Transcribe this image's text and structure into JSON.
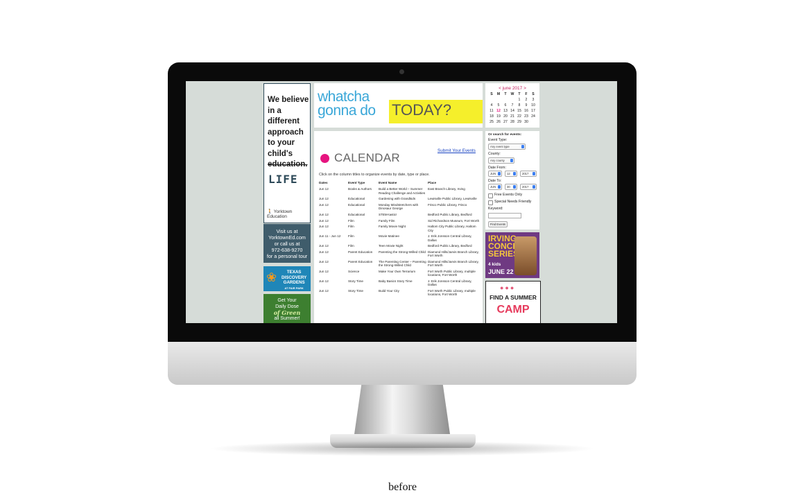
{
  "caption": "before",
  "left_ads": {
    "ad1_lines": [
      "We believe",
      "in a",
      "different",
      "approach",
      "to your",
      "child's",
      "education."
    ],
    "ad1_life": "LIFE",
    "ad1_logo": "Yorktown Education",
    "ad2_lines": [
      "Visit us at",
      "YorktownEd.com",
      "or call us at",
      "972-638-9270",
      "for a personal tour"
    ],
    "ad3_lines": [
      "TEXAS",
      "DISCOVERY",
      "GARDENS",
      "AT FAIR PARK"
    ],
    "ad4_lines": [
      "Get Your",
      "Daily Dose",
      "of Green",
      "all Summer!"
    ]
  },
  "banner": {
    "line1": "whatcha",
    "line2": "gonna do",
    "today": "TODAY?"
  },
  "calendar": {
    "title": "CALENDAR",
    "submit_link": "Submit Your Events",
    "intro": "Click on the column titles to organize events by date, type or place.",
    "columns": [
      "Dates",
      "Event Type",
      "Event Name",
      "Place"
    ],
    "rows": [
      [
        "Jun 12",
        "Books & Authors",
        "Build a Better World – Summer Reading Challenge and Activities",
        "East Branch Library, Irving"
      ],
      [
        "Jun 12",
        "Educational",
        "Gardening with Grandkids",
        "Lewisville Public Library, Lewisville"
      ],
      [
        "Jun 12",
        "Educational",
        "Monday Mindstretchers with Dinosaur George",
        "Frisco Public Library, Frisco"
      ],
      [
        "Jun 12",
        "Educational",
        "STEM-tastic!",
        "Bedford Public Library, Bedford"
      ],
      [
        "Jun 12",
        "Film",
        "Family Film",
        "Sid Richardson Museum, Fort Worth"
      ],
      [
        "Jun 12",
        "Film",
        "Family Movie Night",
        "Haltom City Public Library, Haltom City"
      ],
      [
        "Jun 11 - Jun 12",
        "Film",
        "Movie Matinee",
        "J. Erik Jonsson Central Library, Dallas"
      ],
      [
        "Jun 12",
        "Film",
        "Teen Movie Night",
        "Bedford Public Library, Bedford"
      ],
      [
        "Jun 12",
        "Parent Education",
        "Parenting the Strong-Willed Child",
        "Diamond Hills/Jarvis Branch Library, Fort Worth"
      ],
      [
        "Jun 12",
        "Parent Education",
        "The Parenting Center – Parenting the Strong-Willed Child",
        "Diamond Hills/Jarvis Branch Library, Fort Worth"
      ],
      [
        "Jun 12",
        "Science",
        "Make Your Own Terrarium",
        "Fort Worth Public Library, multiple locations, Fort Worth"
      ],
      [
        "Jun 12",
        "Story Time",
        "Baby Basics Story Time",
        "J. Erik Jonsson Central Library, Dallas"
      ],
      [
        "Jun 12",
        "Story Time",
        "Build Your City",
        "Fort Worth Public Library, multiple locations, Fort Worth"
      ]
    ]
  },
  "mini_calendar": {
    "prev": "<",
    "month": "june 2017",
    "next": ">",
    "dow": [
      "S",
      "M",
      "T",
      "W",
      "T",
      "F",
      "S"
    ],
    "weeks": [
      [
        "",
        "",
        "",
        "",
        "1",
        "2",
        "3"
      ],
      [
        "4",
        "5",
        "6",
        "7",
        "8",
        "9",
        "10"
      ],
      [
        "11",
        "12",
        "13",
        "14",
        "15",
        "16",
        "17"
      ],
      [
        "18",
        "19",
        "20",
        "21",
        "22",
        "23",
        "24"
      ],
      [
        "25",
        "26",
        "27",
        "28",
        "29",
        "30",
        ""
      ]
    ],
    "today": "12"
  },
  "search": {
    "heading": "Or search for events:",
    "event_type_label": "Event Type:",
    "event_type_value": "Any event type",
    "county_label": "County:",
    "county_value": "Any county",
    "date_from_label": "Date From:",
    "date_from": {
      "month": "JUN",
      "day": "12",
      "year": "2017"
    },
    "date_to_label": "Date To:",
    "date_to": {
      "month": "JUN",
      "day": "30",
      "year": "2017"
    },
    "free_label": "Free Events Only",
    "special_label": "Special Needs Friendly",
    "keyword_label": "Keyword:",
    "button": "Find Events"
  },
  "right_ads": {
    "irving_lines": [
      "IRVING",
      "CONCERT",
      "SERIES"
    ],
    "irving_sub": "4 kids",
    "irving_date": "JUNE 22",
    "camp_line1": "FIND A SUMMER",
    "camp_line2": "CAMP"
  }
}
